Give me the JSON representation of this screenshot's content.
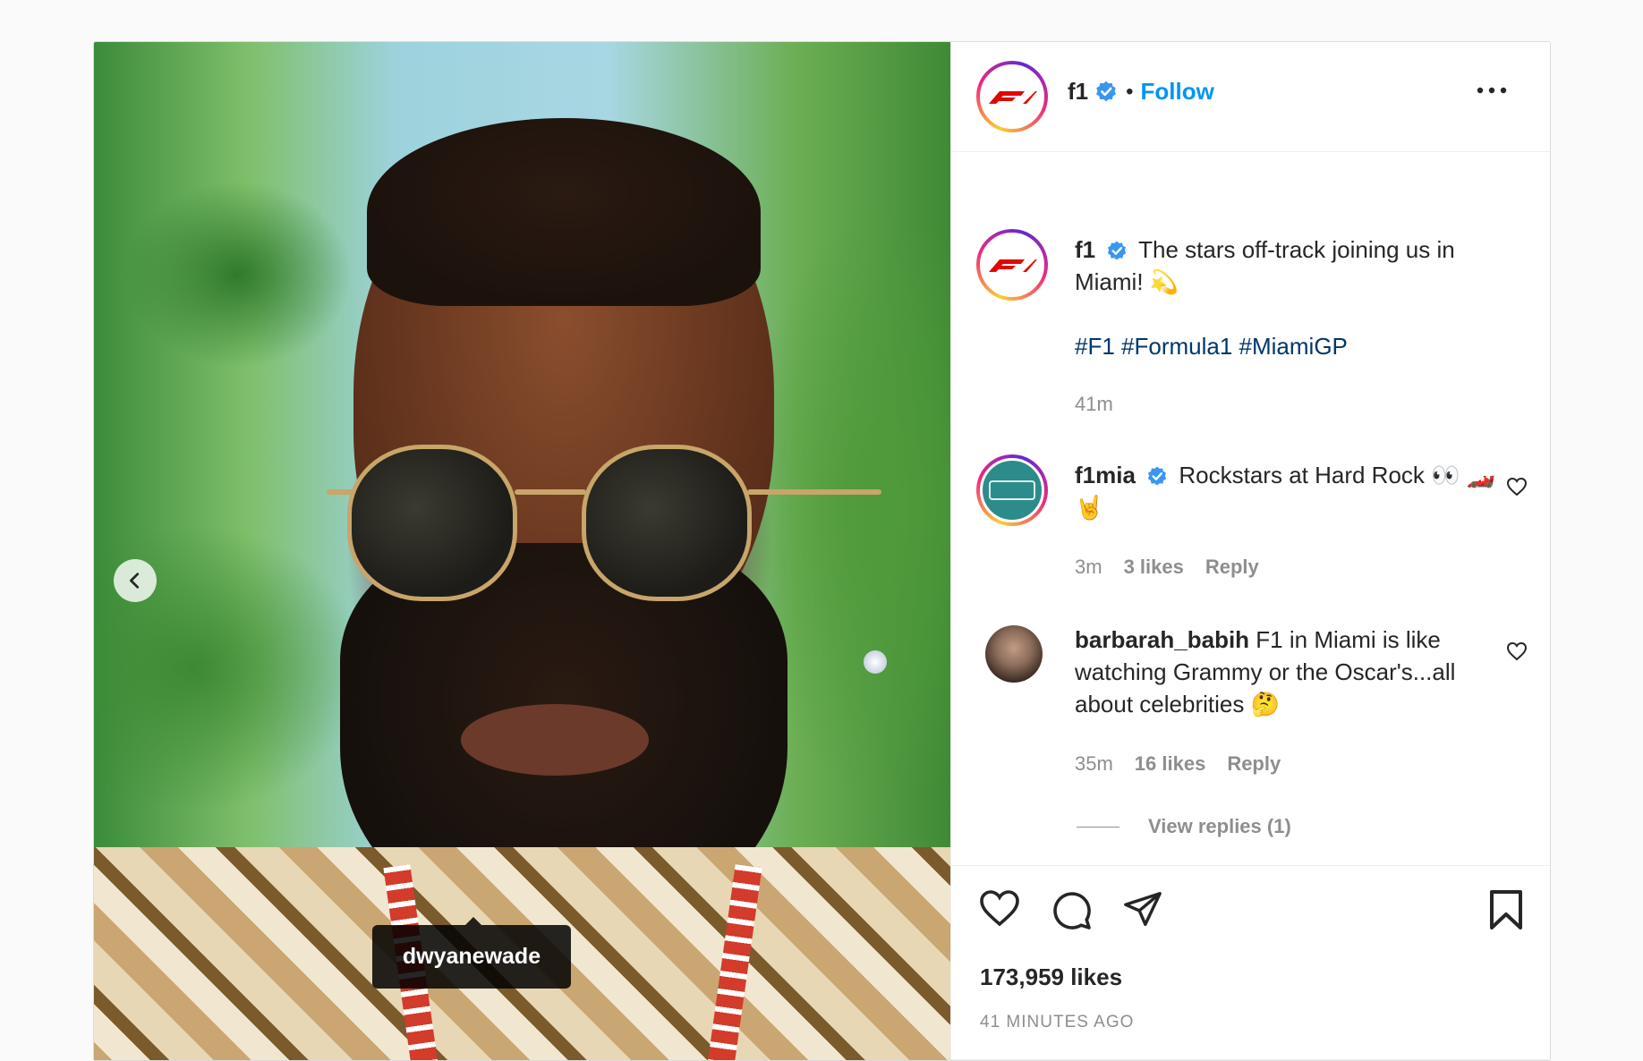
{
  "post": {
    "username": "f1",
    "follow_label": "Follow",
    "separator": "•",
    "media_tag": "dwyanewade",
    "caption_text": "The stars off-track joining us in Miami! 💫",
    "hashtags": "#F1 #Formula1 #MiamiGP",
    "caption_time": "41m",
    "likes": "173,959 likes",
    "time_ago": "41 MINUTES AGO"
  },
  "comments": [
    {
      "username": "f1mia",
      "text": "Rockstars at Hard Rock 👀 🏎️🤘",
      "time": "3m",
      "likes": "3 likes",
      "reply": "Reply"
    },
    {
      "username": "barbarah_babih",
      "text": "F1 in Miami is like watching Grammy or the Oscar's...all about celebrities 🤔",
      "time": "35m",
      "likes": "16 likes",
      "reply": "Reply",
      "view_replies": "View replies (1)"
    }
  ],
  "icons": {
    "verified": "verified-badge-icon",
    "more": "more-options-icon",
    "like": "heart-icon",
    "comment": "comment-icon",
    "share": "share-icon",
    "save": "bookmark-icon",
    "prev": "chevron-left-icon"
  },
  "colors": {
    "accent": "#0095f6",
    "hashtag": "#00376b",
    "f1_red": "#e10600"
  }
}
